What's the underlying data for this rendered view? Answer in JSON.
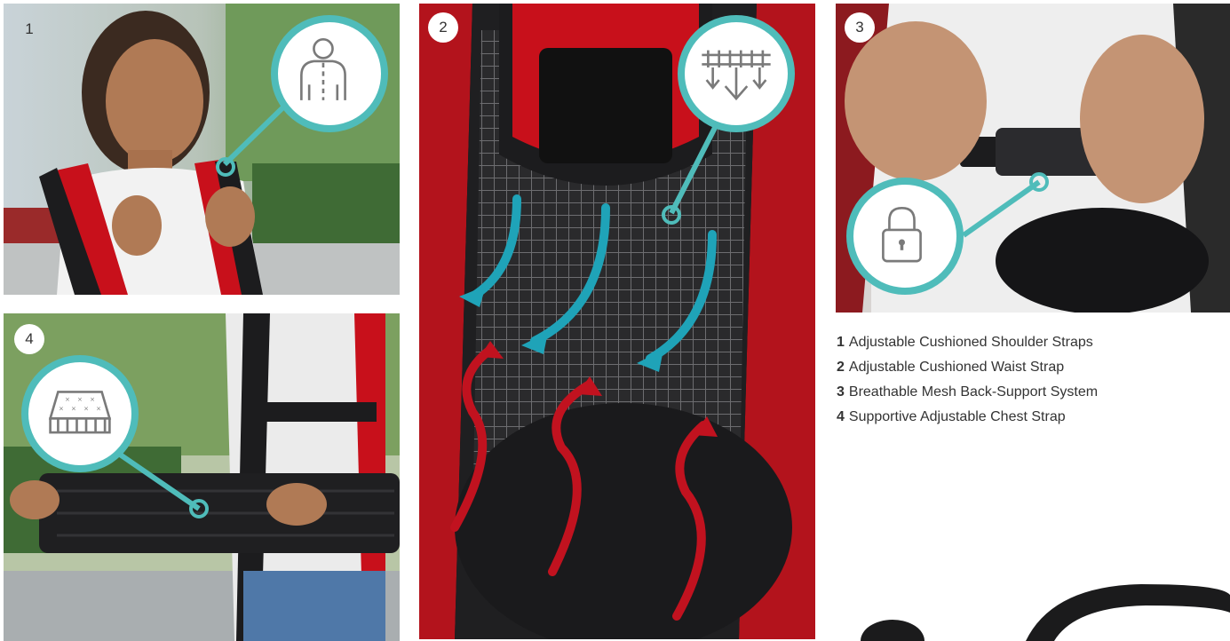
{
  "colors": {
    "accent": "#4fbcba",
    "strap_red": "#c8101b",
    "strap_black": "#1c1c1e",
    "airflow_cool": "#1fa3b8",
    "airflow_warm": "#c1121f"
  },
  "panels": [
    {
      "number": "1",
      "icon": "person-body-icon"
    },
    {
      "number": "2",
      "icon": "mesh-airflow-icon"
    },
    {
      "number": "3",
      "icon": "padlock-icon"
    },
    {
      "number": "4",
      "icon": "cushion-mattress-icon"
    }
  ],
  "legend": [
    {
      "number": "1",
      "text": "Adjustable Cushioned Shoulder Straps"
    },
    {
      "number": "2",
      "text": "Adjustable Cushioned Waist Strap"
    },
    {
      "number": "3",
      "text": "Breathable Mesh Back-Support System"
    },
    {
      "number": "4",
      "text": "Supportive Adjustable Chest Strap"
    }
  ]
}
